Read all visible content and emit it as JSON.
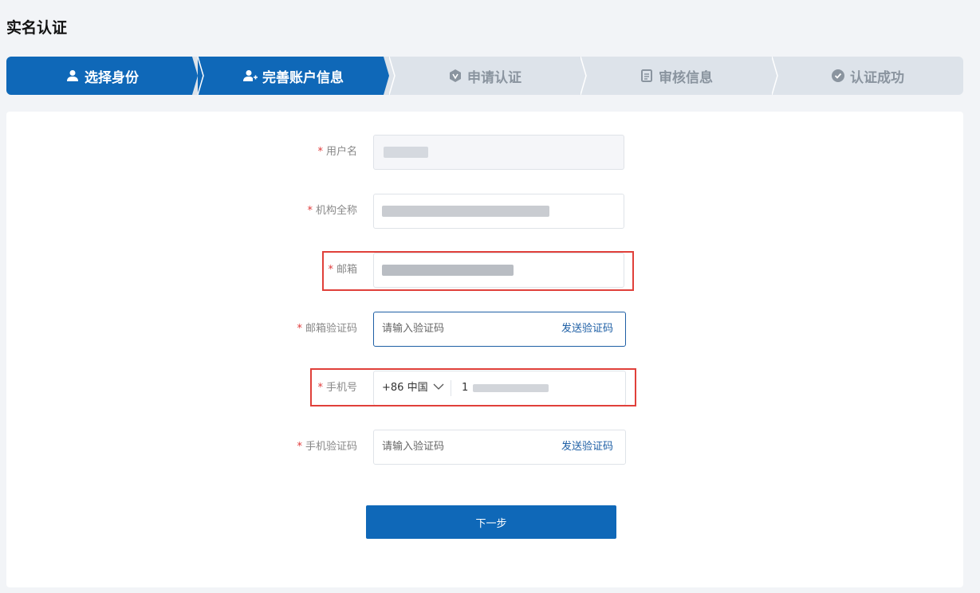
{
  "page": {
    "title": "实名认证"
  },
  "steps": [
    {
      "label": "选择身份",
      "icon": "user-icon",
      "state": "done"
    },
    {
      "label": "完善账户信息",
      "icon": "user-add-icon",
      "state": "active"
    },
    {
      "label": "申请认证",
      "icon": "badge-icon",
      "state": "pending"
    },
    {
      "label": "审核信息",
      "icon": "document-icon",
      "state": "pending"
    },
    {
      "label": "认证成功",
      "icon": "check-circle-icon",
      "state": "pending"
    }
  ],
  "form": {
    "required_mark": "*",
    "username": {
      "label": "用户名"
    },
    "org_name": {
      "label": "机构全称"
    },
    "email": {
      "label": "邮箱"
    },
    "email_code": {
      "label": "邮箱验证码",
      "placeholder": "请输入验证码",
      "send_label": "发送验证码"
    },
    "phone": {
      "label": "手机号",
      "country_code": "+86 中国",
      "value_prefix": "1"
    },
    "phone_code": {
      "label": "手机验证码",
      "placeholder": "请输入验证码",
      "send_label": "发送验证码"
    }
  },
  "actions": {
    "next_label": "下一步"
  },
  "colors": {
    "primary": "#0f68b8",
    "highlight": "#e0403a",
    "required": "#e03a3a"
  }
}
